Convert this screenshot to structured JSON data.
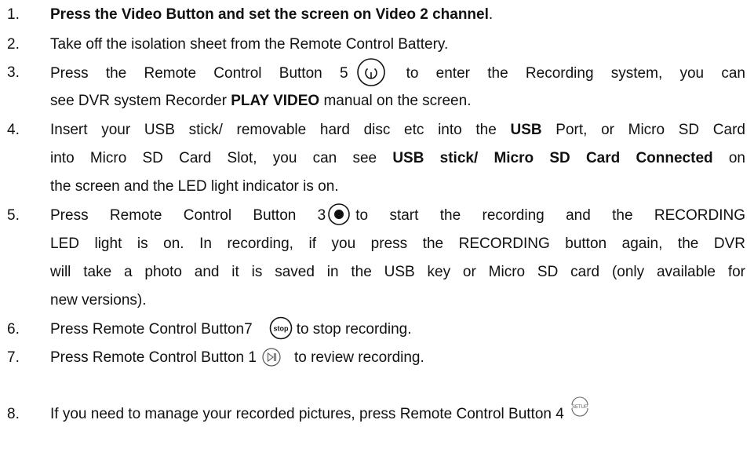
{
  "steps": [
    {
      "num": "1.",
      "lines": [
        {
          "parts": [
            {
              "t": "Press the Video Button and set the screen on Video 2 channel",
              "b": true
            },
            {
              "t": ".",
              "b": false
            }
          ]
        }
      ]
    },
    {
      "num": "2.",
      "lines": [
        {
          "parts": [
            {
              "t": "Take off the isolation sheet from the Remote Control Battery.",
              "b": false
            }
          ]
        }
      ]
    },
    {
      "num": "3.",
      "lines": [
        {
          "parts": [
            {
              "t": "Press the Remote Control Button 5",
              "b": false
            },
            {
              "icon": "power-button-icon"
            },
            {
              "t": "to enter the Recording system, you can",
              "b": false
            }
          ]
        },
        {
          "parts": [
            {
              "t": "see DVR system Recorder ",
              "b": false
            },
            {
              "t": "PLAY VIDEO",
              "b": true
            },
            {
              "t": " manual on the screen.",
              "b": false
            }
          ]
        }
      ]
    },
    {
      "num": "4.",
      "lines": [
        {
          "parts": [
            {
              "t": "Insert your USB stick/ removable hard disc etc into the ",
              "b": false
            },
            {
              "t": "USB",
              "b": true
            },
            {
              "t": " Port, or Micro SD Card",
              "b": false
            }
          ]
        },
        {
          "parts": [
            {
              "t": "into Micro SD Card Slot, you can see ",
              "b": false
            },
            {
              "t": "USB stick/ Micro SD Card Connected",
              "b": true
            },
            {
              "t": " on",
              "b": false
            }
          ]
        },
        {
          "parts": [
            {
              "t": "the screen and the LED light indicator is on.",
              "b": false
            }
          ]
        }
      ]
    },
    {
      "num": "5.",
      "lines": [
        {
          "parts": [
            {
              "t": "Press Remote Control Button 3",
              "b": false
            },
            {
              "icon": "record-button-icon"
            },
            {
              "t": "to start the recording and the RECORDING",
              "b": false
            }
          ]
        },
        {
          "parts": [
            {
              "t": "LED light is on. In recording, if you press the RECORDING button again, the DVR",
              "b": false
            }
          ]
        },
        {
          "parts": [
            {
              "t": "will take a photo and it is saved in the USB key or Micro SD card (only available for",
              "b": false
            }
          ]
        },
        {
          "parts": [
            {
              "t": "new versions).",
              "b": false
            }
          ]
        }
      ]
    },
    {
      "num": "6.",
      "lines": [
        {
          "parts": [
            {
              "t": "Press Remote Control Button7",
              "b": false
            },
            {
              "icon": "stop-button-icon"
            },
            {
              "t": "to stop recording.",
              "b": false
            }
          ]
        }
      ]
    },
    {
      "num": "7.",
      "lines": [
        {
          "parts": [
            {
              "t": "Press Remote Control Button 1",
              "b": false
            },
            {
              "icon": "play-pause-button-icon"
            },
            {
              "t": "to review recording.",
              "b": false
            }
          ]
        }
      ]
    },
    {
      "num": "8.",
      "lines": [
        {
          "parts": [
            {
              "t": "If you need to manage your recorded pictures, press Remote Control Button 4",
              "b": false
            },
            {
              "icon": "setup-button-icon"
            }
          ]
        }
      ]
    }
  ],
  "icons": {
    "stop_label": "STOP",
    "setup_label": "SETUP"
  }
}
